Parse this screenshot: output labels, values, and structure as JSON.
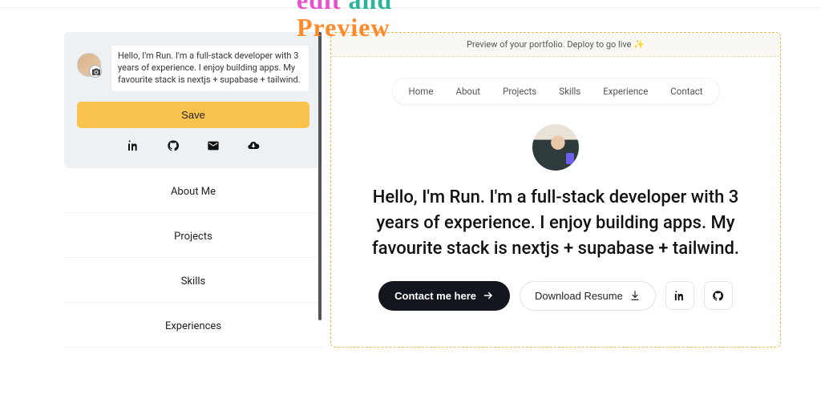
{
  "overlay": {
    "word1": "edit",
    "word2": "and",
    "word3": "Preview"
  },
  "editor": {
    "intro_text": "Hello, I'm Run. I'm a full-stack developer with 3 years of experience. I enjoy building apps. My favourite stack is nextjs + supabase + tailwind.",
    "save_label": "Save",
    "sections": [
      "About Me",
      "Projects",
      "Skills",
      "Experiences"
    ]
  },
  "preview": {
    "banner": "Preview of your portfolio. Deploy to go live ✨",
    "nav": [
      "Home",
      "About",
      "Projects",
      "Skills",
      "Experience",
      "Contact"
    ],
    "hero": "Hello, I'm Run. I'm a full-stack developer with 3 years of experience. I enjoy building apps. My favourite stack is nextjs + supabase + tailwind.",
    "contact_label": "Contact me here",
    "resume_label": "Download Resume"
  }
}
